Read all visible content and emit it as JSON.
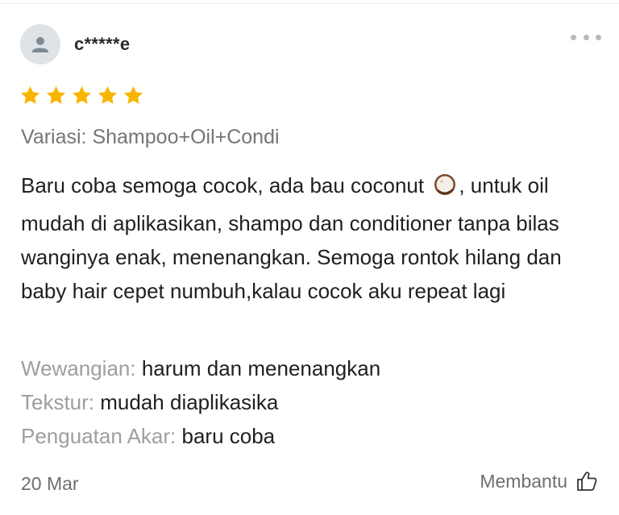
{
  "review": {
    "username": "c*****e",
    "rating": 5,
    "rating_max": 5,
    "star_color": "#f7b500",
    "variant_text": "Variasi: Shampoo+Oil+Condi",
    "body_before_icon": "Baru coba semoga cocok, ada bau coconut ",
    "body_icon": "coconut-icon",
    "body_after_icon": ", untuk oil mudah di aplikasikan, shampo dan conditioner tanpa bilas wanginya enak, menenangkan. Semoga rontok hilang dan baby hair cepet numbuh,kalau cocok aku repeat lagi",
    "attributes": [
      {
        "label": "Wewangian:",
        "value": "harum dan menenangkan"
      },
      {
        "label": "Tekstur:",
        "value": "mudah diaplikasika"
      },
      {
        "label": "Penguatan Akar:",
        "value": "baru coba"
      }
    ],
    "date": "20 Mar",
    "helpful_label": "Membantu",
    "helpful_icon": "thumbs-up-icon",
    "more_icon": "more-dots-icon",
    "avatar_icon": "user-icon"
  }
}
